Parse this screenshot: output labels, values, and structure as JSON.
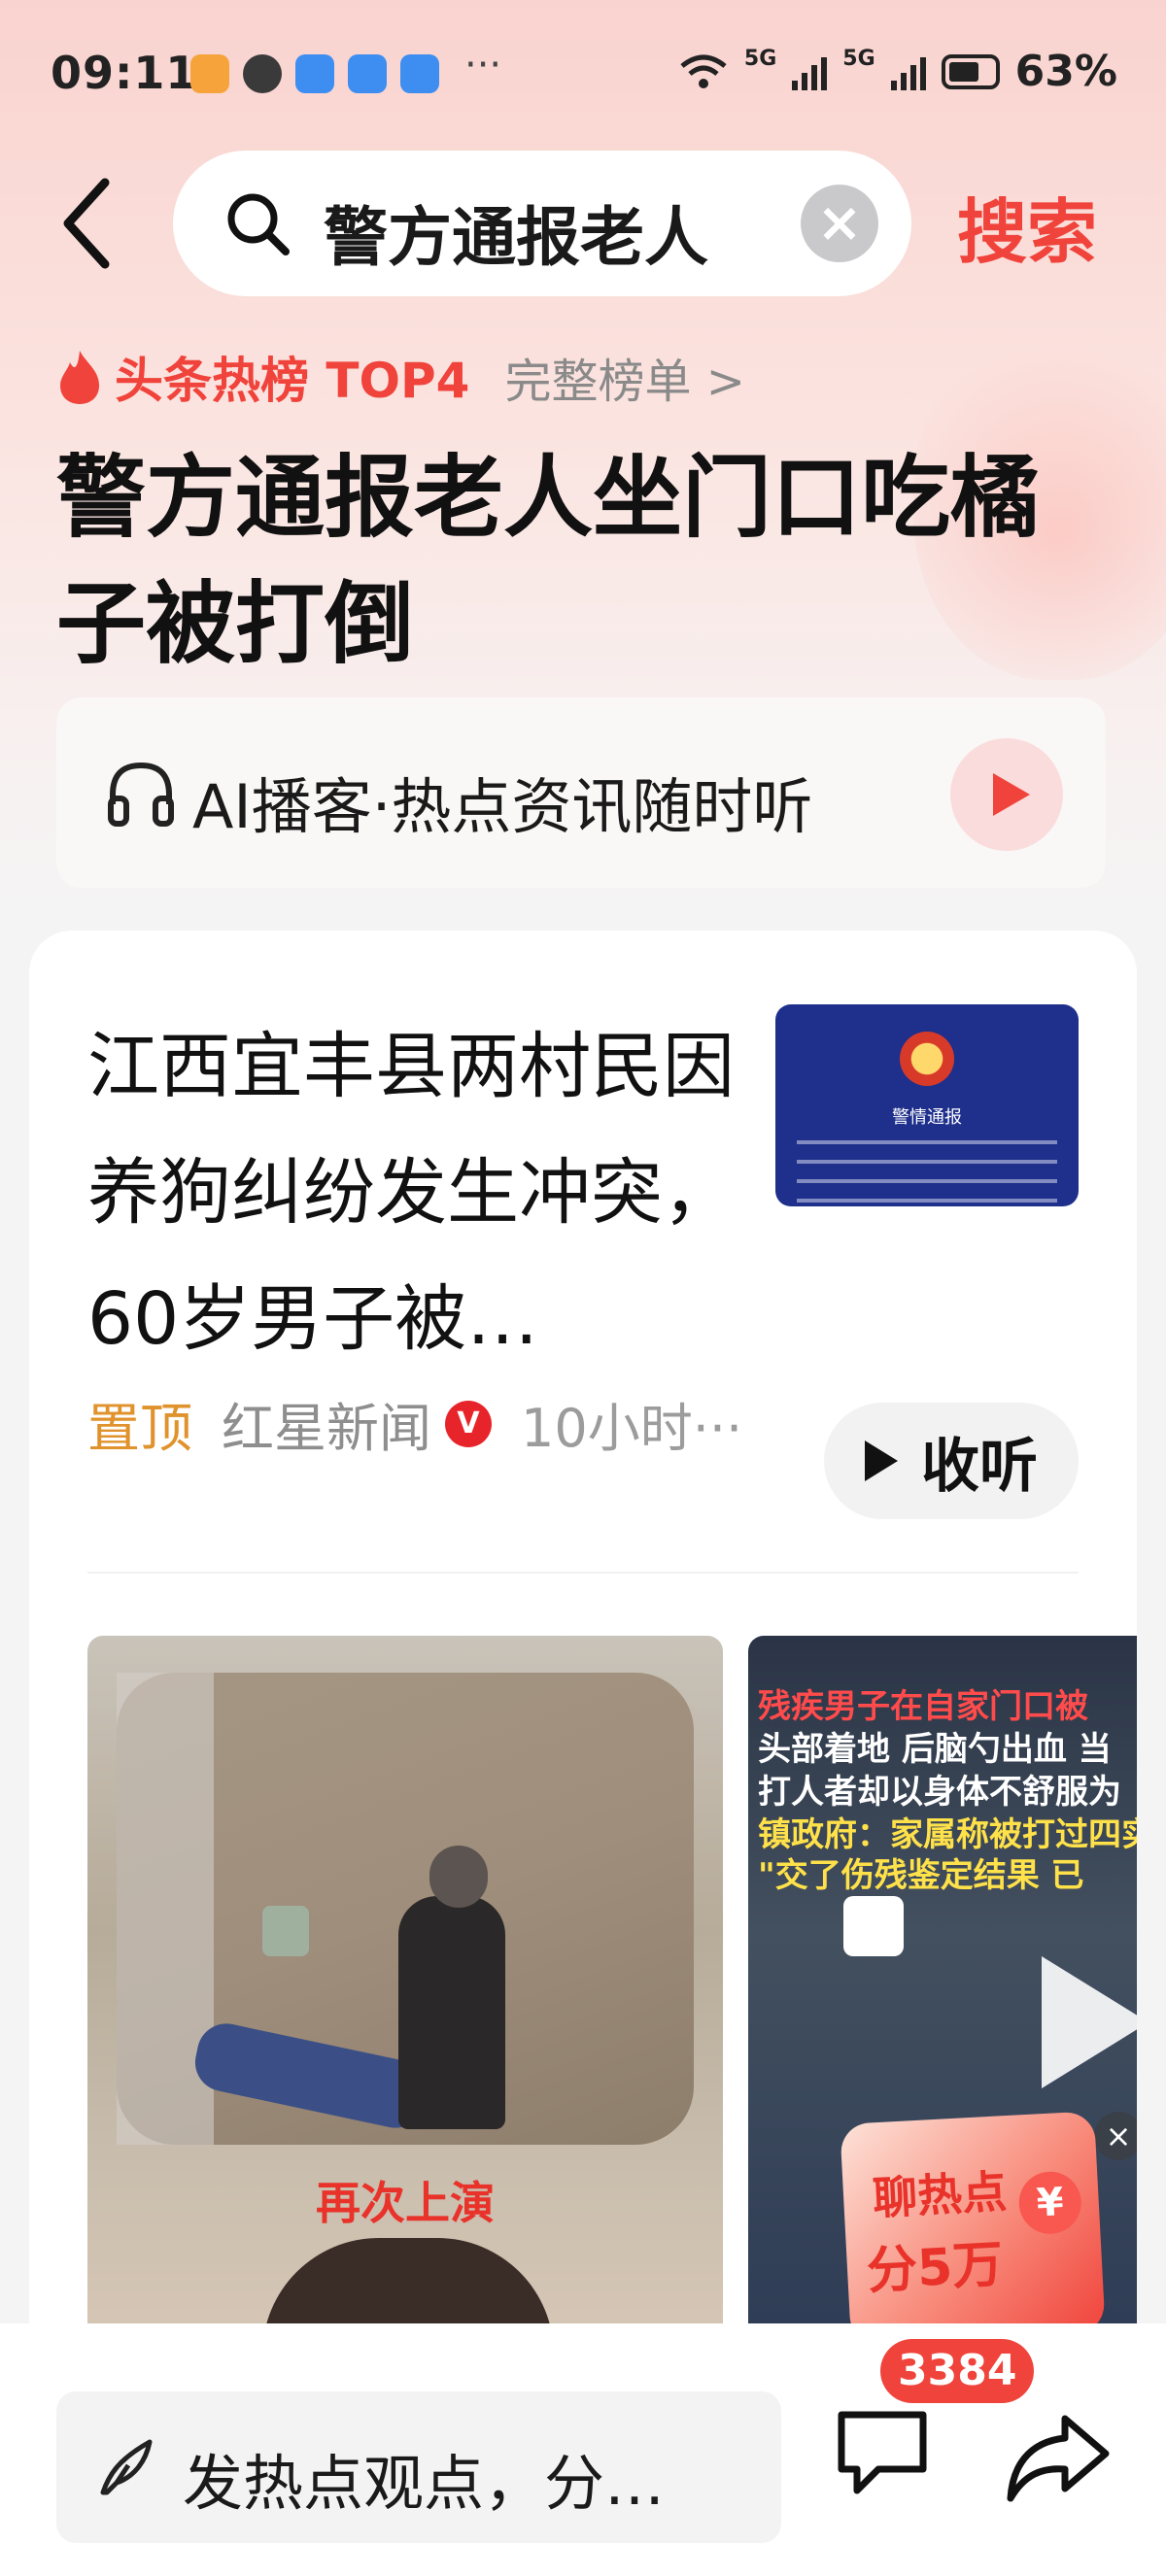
{
  "status_bar": {
    "time": "09:11",
    "network_1": "5G",
    "network_2": "5G",
    "battery": "63%",
    "more": "···"
  },
  "search": {
    "query": "警方通报老人",
    "submit_label": "搜索"
  },
  "hot_rank": {
    "label": "头条热榜 TOP4",
    "full_list": "完整榜单 >",
    "headline": "警方通报老人坐门口吃橘子被打倒"
  },
  "podcast": {
    "label": "AI播客·热点资讯随时听"
  },
  "article": {
    "title": "江西宜丰县两村民因养狗纠纷发生冲突，60岁男子被…",
    "pinned": "置顶",
    "source": "红星新闻",
    "verified_badge": "V",
    "age": "10小时···",
    "listen_label": "收听",
    "thumb_title": "警情通报"
  },
  "video_1": {
    "caption": "再次上演"
  },
  "video_2": {
    "overlay_lines": [
      "残疾男子在自家门口被",
      "头部着地 后脑勺出血 当",
      "打人者却以身体不舒服为",
      "镇政府：家属称被打过四实",
      "\"交了伤残鉴定结果 已"
    ]
  },
  "reward": {
    "line1": "聊热点",
    "line2": "分5万",
    "coin": "¥"
  },
  "bottom_bar": {
    "comment_placeholder": "发热点观点，分…",
    "comment_count": "3384"
  },
  "colors": {
    "accent_red": "#f0433b",
    "pinned_orange": "#e0922c",
    "header_gradient_top": "#f9d3cf"
  },
  "icons": [
    "back-icon",
    "search-icon",
    "clear-icon",
    "flame-icon",
    "chevron-right-icon",
    "headphones-icon",
    "play-icon",
    "verified-icon",
    "pen-icon",
    "comment-icon",
    "share-icon",
    "close-icon"
  ]
}
